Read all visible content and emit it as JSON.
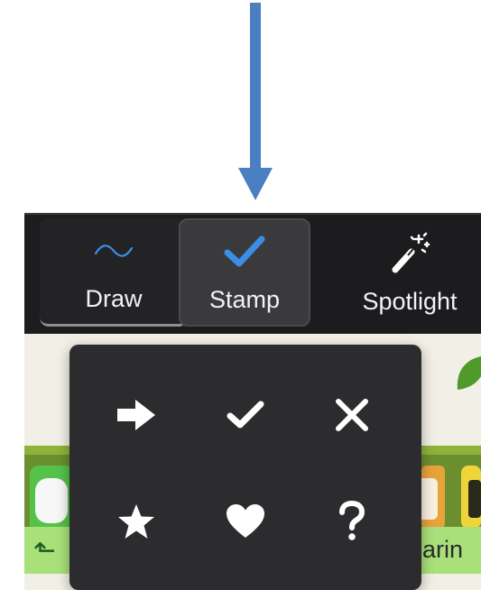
{
  "toolbar": {
    "tools": [
      {
        "label": "Draw",
        "icon": "wave-icon"
      },
      {
        "label": "Stamp",
        "icon": "checkmark-icon",
        "selected": true
      },
      {
        "label": "Spotlight",
        "icon": "magic-wand-icon"
      }
    ]
  },
  "stamp_popup": {
    "stamps": [
      "arrow-right-icon",
      "checkmark-icon",
      "x-mark-icon",
      "star-icon",
      "heart-icon",
      "question-mark-icon"
    ]
  },
  "background": {
    "partial_label": "harin"
  },
  "colors": {
    "accent_blue": "#3b8de6",
    "arrow_blue": "#4a7fc1",
    "toolbar_bg": "#1c1c1e",
    "popup_bg": "#2c2c2e"
  }
}
